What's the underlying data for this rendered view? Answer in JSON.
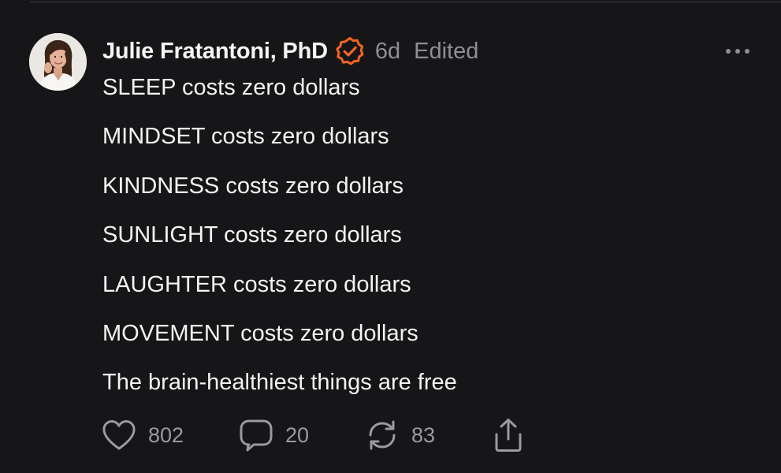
{
  "post": {
    "author": {
      "name": "Julie Fratantoni, PhD",
      "avatar_icon": "profile-photo",
      "verified": true,
      "verified_color": "#f26522"
    },
    "time": "6d",
    "edited_label": "Edited",
    "more_icon": "more-horizontal-icon",
    "lines": [
      "SLEEP costs zero dollars",
      "MINDSET costs zero dollars",
      "KINDNESS costs zero dollars",
      "SUNLIGHT costs zero dollars",
      "LAUGHTER costs zero dollars",
      "MOVEMENT costs zero dollars",
      "The brain-healthiest things are free"
    ]
  },
  "actions": {
    "like": {
      "icon": "heart-icon",
      "count": "802"
    },
    "reply": {
      "icon": "comment-icon",
      "count": "20"
    },
    "repost": {
      "icon": "repost-icon",
      "count": "83"
    },
    "share": {
      "icon": "share-icon"
    }
  },
  "colors": {
    "background": "#161618",
    "text": "#f3f3f3",
    "muted": "#8e8e93",
    "accent": "#f26522"
  }
}
